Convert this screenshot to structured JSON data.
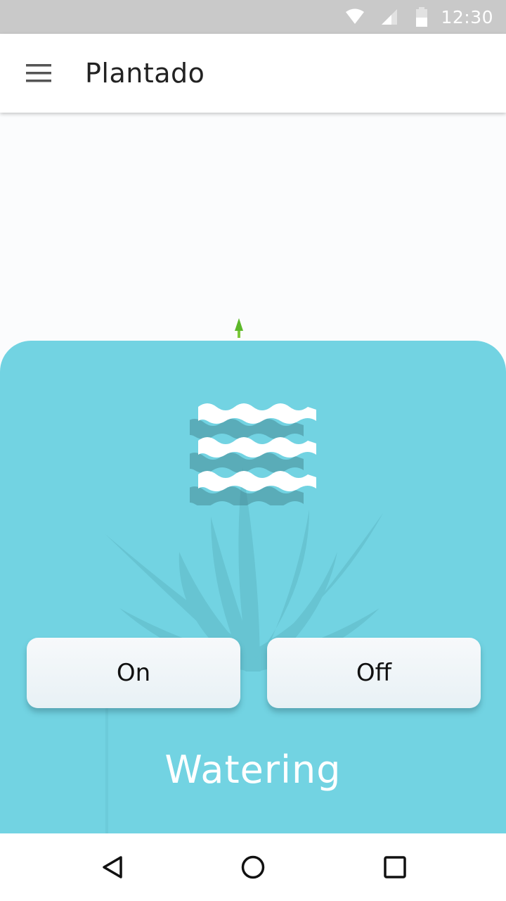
{
  "status_bar": {
    "time": "12:30",
    "icons": [
      "wifi-icon",
      "cellular-signal-icon",
      "battery-icon"
    ]
  },
  "app_bar": {
    "title": "Plantado",
    "menu_icon": "hamburger-menu-icon"
  },
  "panel": {
    "icon": "water-waves-icon",
    "on_label": "On",
    "off_label": "Off",
    "label": "Watering",
    "background_color": "#72d3e2"
  },
  "nav_bar": {
    "icons": [
      "back-icon",
      "home-icon",
      "recents-icon"
    ]
  }
}
